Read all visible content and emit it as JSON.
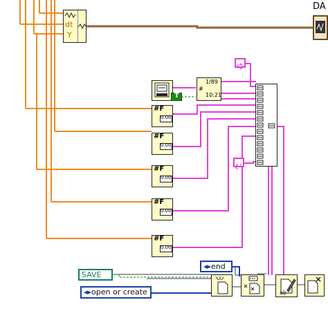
{
  "diagram": {
    "top_label": "DA",
    "waveform_bundle": {
      "dt_label": "dt",
      "y_label": "Y",
      "icon": "waveform-icon"
    },
    "format_date_time": {
      "date_text": "1/89",
      "time_text": "10:21",
      "icon": "date-time-icon"
    },
    "boolean_constant": "T",
    "format_string_nodes": [
      {
        "label": "#F",
        "display": "0.00"
      },
      {
        "label": "#F",
        "display": "0.00"
      },
      {
        "label": "#F",
        "display": "0.00"
      },
      {
        "label": "#F",
        "display": "0.00"
      },
      {
        "label": "#F",
        "display": "0.00"
      }
    ],
    "save_control": "SAVE",
    "end_enum": "end",
    "open_mode_enum": "open or create",
    "file_nodes": {
      "open": "open-file-icon",
      "seek": "set-file-position-icon",
      "write": "write-to-text-file-icon",
      "close": "close-file-icon"
    }
  }
}
